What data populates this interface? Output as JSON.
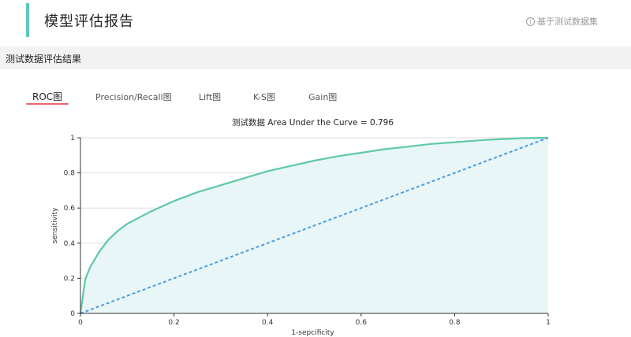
{
  "header": {
    "title": "模型评估报告",
    "dataset_note": "基于测试数据集",
    "info_icon": "info-circle-icon"
  },
  "section": {
    "title": "测试数据评估结果"
  },
  "tabs": [
    {
      "label": "ROC图",
      "active": true
    },
    {
      "label": "Precision/Recall图",
      "active": false
    },
    {
      "label": "Lift图",
      "active": false
    },
    {
      "label": "K-S图",
      "active": false
    },
    {
      "label": "Gain图",
      "active": false
    }
  ],
  "colors": {
    "accent": "#5ec8bd",
    "tab_underline": "#e8676b",
    "curve": "#5ec8a8",
    "curve_fill": "#e8f6f7",
    "diagonal": "#4a9ee0"
  },
  "chart_data": {
    "type": "area",
    "title": "测试数据 Area Under the Curve = 0.796",
    "xlabel": "1-sepcificity",
    "ylabel": "sensitivity",
    "xlim": [
      0,
      1
    ],
    "ylim": [
      0,
      1
    ],
    "x_ticks": [
      "0",
      "0.2",
      "0.4",
      "0.6",
      "0.8",
      "1"
    ],
    "y_ticks": [
      "0",
      "0.2",
      "0.4",
      "0.6",
      "0.8",
      "1"
    ],
    "grid": true,
    "series": [
      {
        "style": "solid-filled",
        "x": [
          0,
          0.01,
          0.02,
          0.04,
          0.06,
          0.08,
          0.1,
          0.15,
          0.2,
          0.25,
          0.3,
          0.35,
          0.4,
          0.45,
          0.5,
          0.55,
          0.6,
          0.65,
          0.7,
          0.75,
          0.8,
          0.85,
          0.9,
          0.95,
          1
        ],
        "y": [
          0,
          0.19,
          0.26,
          0.35,
          0.42,
          0.47,
          0.51,
          0.58,
          0.64,
          0.69,
          0.73,
          0.77,
          0.81,
          0.84,
          0.87,
          0.895,
          0.915,
          0.935,
          0.95,
          0.965,
          0.975,
          0.985,
          0.993,
          0.998,
          1
        ]
      },
      {
        "style": "dashed",
        "x": [
          0,
          1
        ],
        "y": [
          0,
          1
        ]
      }
    ]
  }
}
